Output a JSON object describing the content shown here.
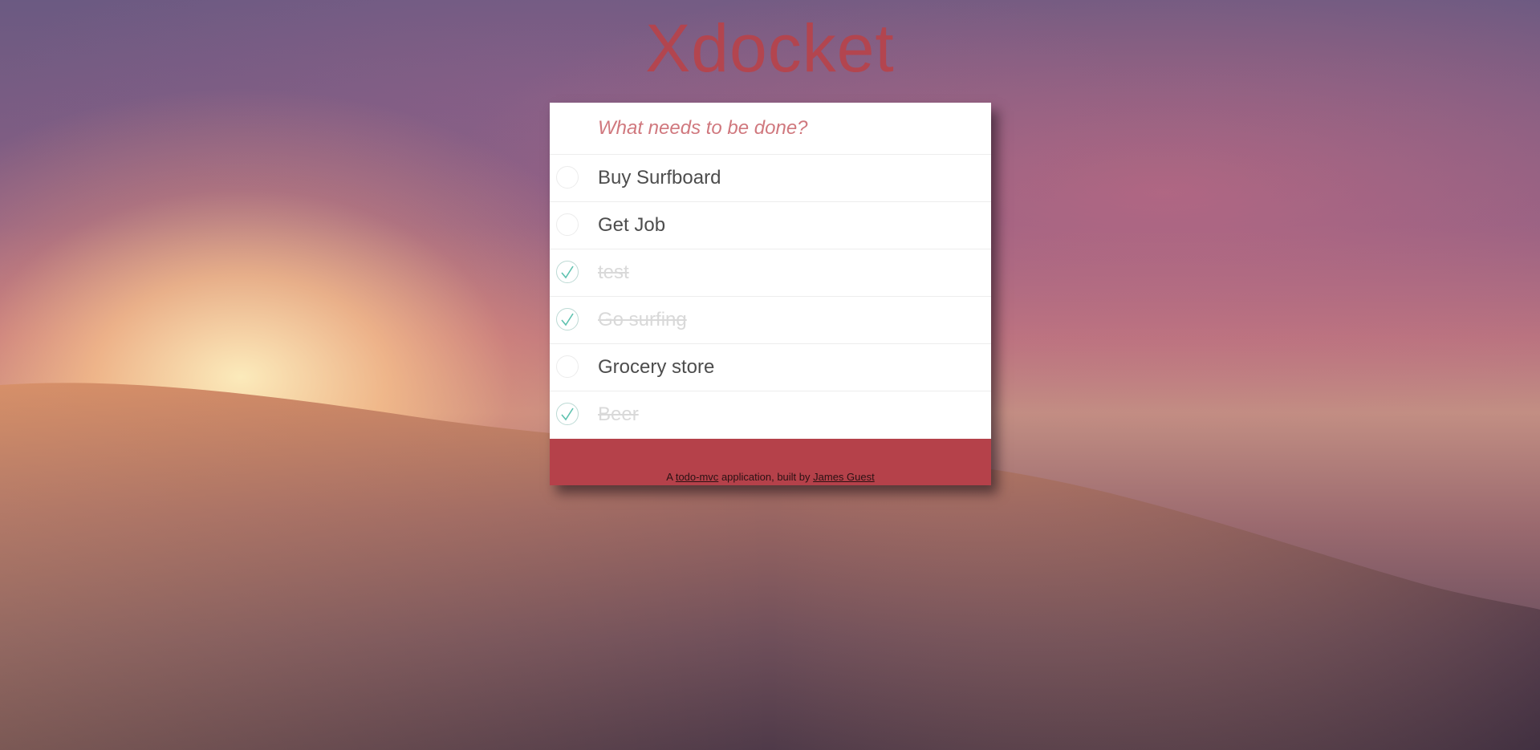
{
  "app": {
    "title": "Xdocket"
  },
  "new_todo": {
    "placeholder": "What needs to be done?",
    "value": ""
  },
  "todos": [
    {
      "label": "Buy Surfboard",
      "completed": false
    },
    {
      "label": "Get Job",
      "completed": false
    },
    {
      "label": "test",
      "completed": true
    },
    {
      "label": "Go surfing",
      "completed": true
    },
    {
      "label": "Grocery store",
      "completed": false
    },
    {
      "label": "Beer",
      "completed": true
    }
  ],
  "footer": {
    "prefix": "A",
    "link1": "todo-mvc",
    "middle": "application, built by",
    "link2": "James Guest"
  },
  "colors": {
    "title": "#b7434b",
    "footer_bg": "#b5414a",
    "check": "#5dc2af",
    "placeholder": "#d0787e"
  },
  "icons": {
    "check": "checkmark-icon"
  }
}
